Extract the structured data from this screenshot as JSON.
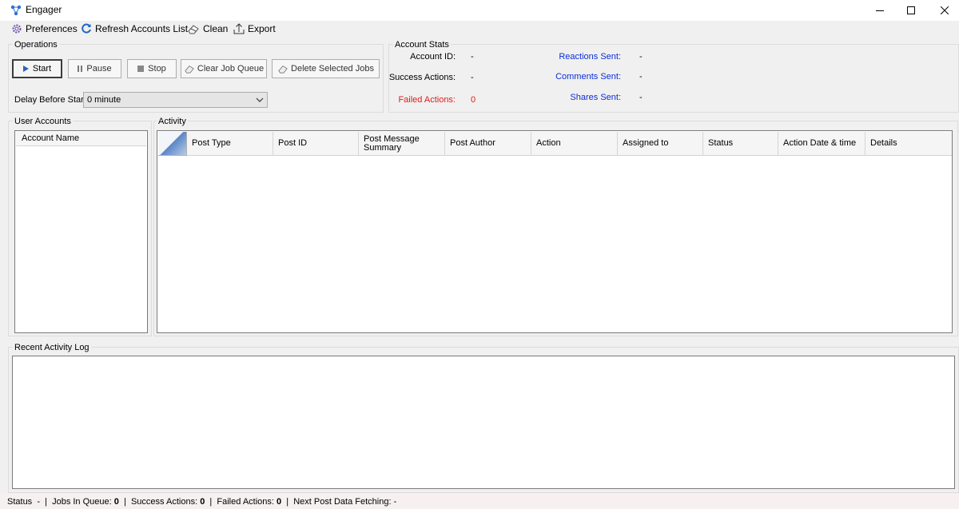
{
  "window": {
    "title": "Engager"
  },
  "menu": {
    "preferences": "Preferences",
    "refresh": "Refresh Accounts List",
    "clean": "Clean",
    "export": "Export"
  },
  "operations": {
    "group_label": "Operations",
    "start": "Start",
    "pause": "Pause",
    "stop": "Stop",
    "clear_queue": "Clear Job Queue",
    "delete_jobs": "Delete Selected Jobs",
    "delay_label": "Delay Before Start",
    "delay_value": "0 minute"
  },
  "stats": {
    "group_label": "Account Stats",
    "account_id_label": "Account ID:",
    "account_id_value": "-",
    "success_label": "Success Actions:",
    "success_value": "-",
    "failed_label": "Failed Actions:",
    "failed_value": "0",
    "reactions_label": "Reactions Sent:",
    "reactions_value": "-",
    "comments_label": "Comments Sent:",
    "comments_value": "-",
    "shares_label": "Shares Sent:",
    "shares_value": "-",
    "colors": {
      "label_blue": "#0c2fd6",
      "failed_red": "#e21b1b"
    }
  },
  "user_accounts": {
    "group_label": "User Accounts",
    "column": "Account Name"
  },
  "activity": {
    "group_label": "Activity",
    "columns": [
      "Post Type",
      "Post ID",
      "Post Message Summary",
      "Post Author",
      "Action",
      "Assigned to",
      "Status",
      "Action Date & time",
      "Details"
    ]
  },
  "log": {
    "group_label": "Recent Activity Log"
  },
  "statusbar": {
    "status_label": "Status",
    "status_value": "-",
    "jobs_label": "Jobs In Queue:",
    "jobs_value": "0",
    "success_label": "Success Actions:",
    "success_value": "0",
    "failed_label": "Failed Actions:",
    "failed_value": "0",
    "next_label": "Next Post Data Fetching:",
    "next_value": "-"
  }
}
